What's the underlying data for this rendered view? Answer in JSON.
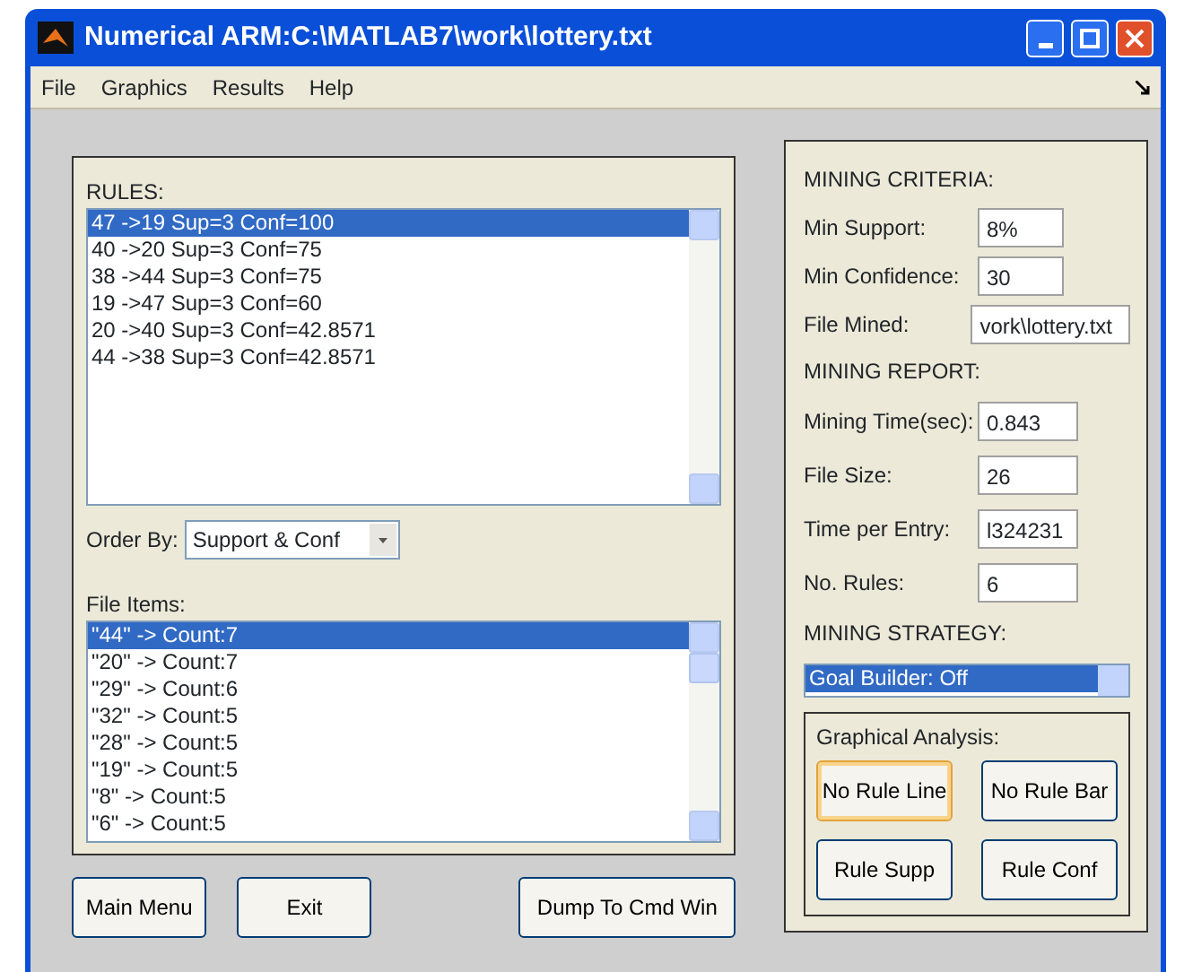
{
  "window": {
    "title": "Numerical ARM:C:\\MATLAB7\\work\\lottery.txt"
  },
  "menu": [
    "File",
    "Graphics",
    "Results",
    "Help"
  ],
  "rules": {
    "label": "RULES:",
    "items": [
      {
        "text": "47 ->19 Sup=3 Conf=100",
        "selected": true
      },
      {
        "text": "40 ->20 Sup=3 Conf=75",
        "selected": false
      },
      {
        "text": "38 ->44 Sup=3 Conf=75",
        "selected": false
      },
      {
        "text": "19 ->47 Sup=3 Conf=60",
        "selected": false
      },
      {
        "text": "20 ->40 Sup=3 Conf=42.8571",
        "selected": false
      },
      {
        "text": "44 ->38 Sup=3 Conf=42.8571",
        "selected": false
      }
    ]
  },
  "order_by": {
    "label": "Order By:",
    "value": "Support & Conf"
  },
  "file_items": {
    "label": "File Items:",
    "items": [
      {
        "text": "\"44\" -> Count:7",
        "selected": true
      },
      {
        "text": "\"20\" -> Count:7",
        "selected": false
      },
      {
        "text": "\"29\" -> Count:6",
        "selected": false
      },
      {
        "text": "\"32\" -> Count:5",
        "selected": false
      },
      {
        "text": "\"28\" -> Count:5",
        "selected": false
      },
      {
        "text": "\"19\" -> Count:5",
        "selected": false
      },
      {
        "text": "\"8\" -> Count:5",
        "selected": false
      },
      {
        "text": "\"6\" -> Count:5",
        "selected": false
      }
    ]
  },
  "bottom_buttons": [
    "Main Menu",
    "Exit",
    "Dump To Cmd Win"
  ],
  "criteria": {
    "heading": "MINING CRITERIA:",
    "fields": [
      {
        "label": "Min Support:",
        "value": "8%"
      },
      {
        "label": "Min Confidence:",
        "value": "30"
      },
      {
        "label": "File Mined:",
        "value": "vork\\lottery.txt"
      }
    ]
  },
  "report": {
    "heading": "MINING REPORT:",
    "fields": [
      {
        "label": "Mining Time(sec):",
        "value": "0.843"
      },
      {
        "label": "File Size:",
        "value": "26"
      },
      {
        "label": "Time per Entry:",
        "value": "l324231"
      },
      {
        "label": "No. Rules:",
        "value": "6"
      }
    ]
  },
  "strategy": {
    "heading": "MINING STRATEGY:",
    "items": [
      {
        "text": "Goal Builder: Off",
        "selected": true
      }
    ]
  },
  "graphical_analysis": {
    "title": "Graphical Analysis:",
    "buttons": [
      {
        "label": "No Rule Line",
        "focused": true
      },
      {
        "label": "No Rule Bar",
        "focused": false
      },
      {
        "label": "Rule Supp",
        "focused": false
      },
      {
        "label": "Rule Conf",
        "focused": false
      }
    ]
  }
}
